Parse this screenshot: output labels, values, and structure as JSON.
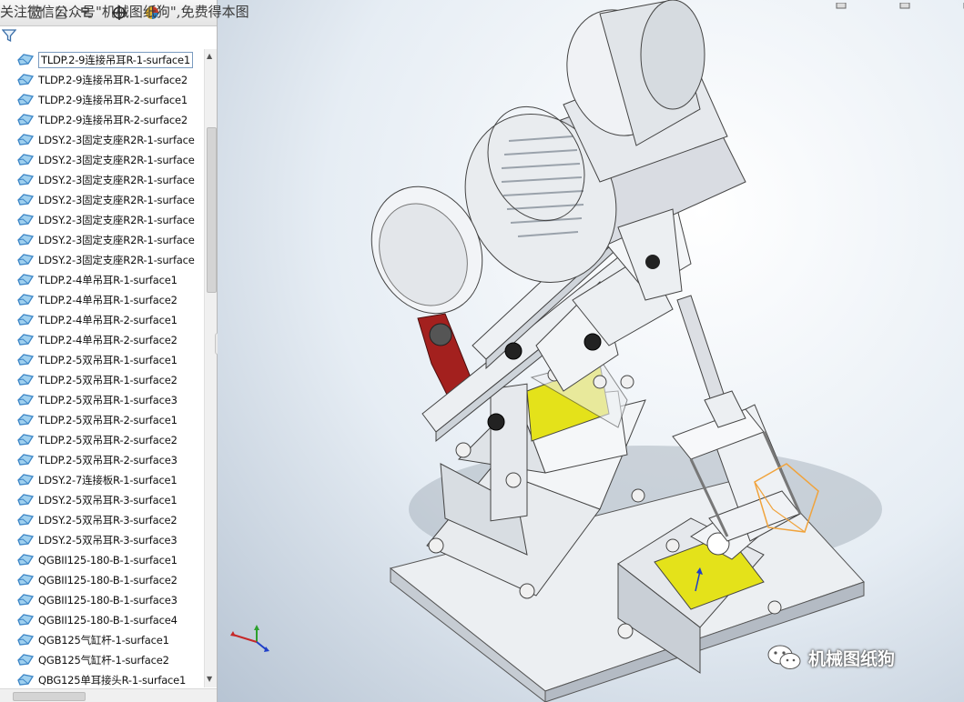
{
  "watermark_top": "关注微信公众号\"机械图纸狗\",免费得本图",
  "brand_text": "机械图纸狗",
  "toolbar": {
    "icons": [
      "feature-manager-icon",
      "property-manager-icon",
      "configuration-manager-icon",
      "dimxpert-icon",
      "display-manager-icon"
    ]
  },
  "tree": {
    "items": [
      {
        "label": "TLDP.2-9连接吊耳R-1-surface1",
        "selected": true
      },
      {
        "label": "TLDP.2-9连接吊耳R-1-surface2"
      },
      {
        "label": "TLDP.2-9连接吊耳R-2-surface1"
      },
      {
        "label": "TLDP.2-9连接吊耳R-2-surface2"
      },
      {
        "label": "LDSY.2-3固定支座R2R-1-surface"
      },
      {
        "label": "LDSY.2-3固定支座R2R-1-surface"
      },
      {
        "label": "LDSY.2-3固定支座R2R-1-surface"
      },
      {
        "label": "LDSY.2-3固定支座R2R-1-surface"
      },
      {
        "label": "LDSY.2-3固定支座R2R-1-surface"
      },
      {
        "label": "LDSY.2-3固定支座R2R-1-surface"
      },
      {
        "label": "LDSY.2-3固定支座R2R-1-surface"
      },
      {
        "label": "TLDP.2-4单吊耳R-1-surface1"
      },
      {
        "label": "TLDP.2-4单吊耳R-1-surface2"
      },
      {
        "label": "TLDP.2-4单吊耳R-2-surface1"
      },
      {
        "label": "TLDP.2-4单吊耳R-2-surface2"
      },
      {
        "label": "TLDP.2-5双吊耳R-1-surface1"
      },
      {
        "label": "TLDP.2-5双吊耳R-1-surface2"
      },
      {
        "label": "TLDP.2-5双吊耳R-1-surface3"
      },
      {
        "label": "TLDP.2-5双吊耳R-2-surface1"
      },
      {
        "label": "TLDP.2-5双吊耳R-2-surface2"
      },
      {
        "label": "TLDP.2-5双吊耳R-2-surface3"
      },
      {
        "label": "LDSY.2-7连接板R-1-surface1"
      },
      {
        "label": "LDSY.2-5双吊耳R-3-surface1"
      },
      {
        "label": "LDSY.2-5双吊耳R-3-surface2"
      },
      {
        "label": "LDSY.2-5双吊耳R-3-surface3"
      },
      {
        "label": "QGBII125-180-B-1-surface1"
      },
      {
        "label": "QGBII125-180-B-1-surface2"
      },
      {
        "label": "QGBII125-180-B-1-surface3"
      },
      {
        "label": "QGBII125-180-B-1-surface4"
      },
      {
        "label": "QGB125气缸杆-1-surface1"
      },
      {
        "label": "QGB125气缸杆-1-surface2"
      },
      {
        "label": "QBG125单耳接头R-1-surface1"
      }
    ]
  },
  "colors": {
    "panel_bg": "#ffffff",
    "surface_icon": "#3d86c6",
    "viewport_bg": "#dfe7ef",
    "motor_gray": "#d9dce2",
    "frame_gray": "#e3e6ea",
    "yellow_face": "#e4e21a",
    "red_lever": "#a3201e"
  }
}
